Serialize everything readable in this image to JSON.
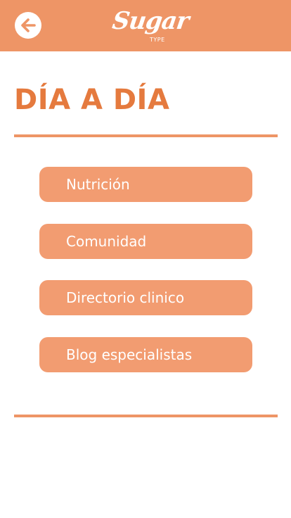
{
  "header": {
    "back_icon": "arrow-left-icon",
    "logo": {
      "word": "Sugar",
      "sub": "TYPE"
    },
    "colors": {
      "bar": "#ee9566",
      "icon": "#ffffff"
    }
  },
  "main": {
    "title": "DÍA A DÍA",
    "title_color": "#e57a3e",
    "menu": [
      {
        "label": "Nutrición"
      },
      {
        "label": "Comunidad"
      },
      {
        "label": "Directorio clinico"
      },
      {
        "label": "Blog especialistas"
      }
    ],
    "button_color": "#f29c71",
    "divider_color": "#ee9566"
  }
}
